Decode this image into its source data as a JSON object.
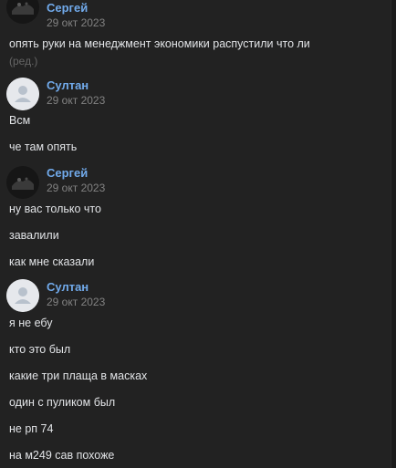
{
  "messages": [
    {
      "author": "Сергей",
      "date": "29 окт 2023",
      "avatar": "photo-avatar",
      "lines": [
        "опять руки на менеджмент экономики распустили что ли"
      ],
      "edited": "(ред.)"
    },
    {
      "author": "Султан",
      "date": "29 окт 2023",
      "avatar": "default-user-avatar",
      "lines": [
        "Всм",
        "че там опять"
      ]
    },
    {
      "author": "Сергей",
      "date": "29 окт 2023",
      "avatar": "photo-avatar",
      "lines": [
        "ну вас только что",
        "завалили",
        "как мне сказали"
      ]
    },
    {
      "author": "Султан",
      "date": "29 окт 2023",
      "avatar": "default-user-avatar",
      "lines": [
        "я не ебу",
        "кто это был",
        "какие три плаща в масках",
        "один с пуликом был",
        "не рп 74",
        "на м249 сав похоже"
      ]
    }
  ],
  "colors": {
    "background": "#222222",
    "author": "#71aaeb",
    "date": "#828282",
    "text": "#e1e3e6"
  }
}
